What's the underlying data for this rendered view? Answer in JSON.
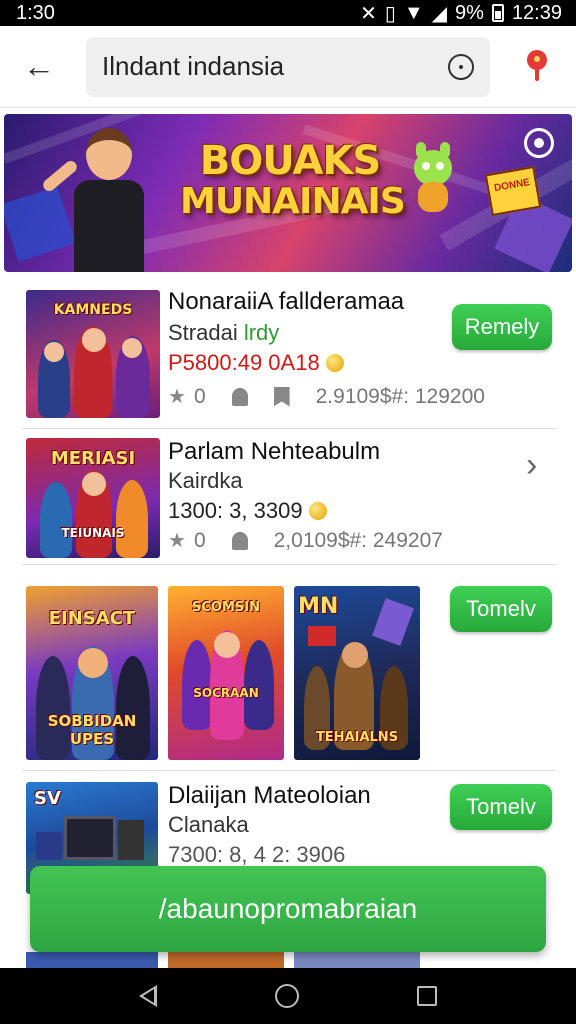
{
  "status_bar": {
    "time": "1:30",
    "battery": "9%",
    "clock": "12:39"
  },
  "search": {
    "value": "Ilndant indansia"
  },
  "banner": {
    "title_line1": "BOUAKS",
    "title_line2": "MUNAINAIS",
    "card_text": "DONNE"
  },
  "items": [
    {
      "thumb_label": "KAMNEDS",
      "title": "NonaraiiA fallderamaa",
      "subtitle": "Stradai",
      "subtitle_highlight": "lrdy",
      "price": "P5800:49 0A18",
      "stats": {
        "stars": "0",
        "meta": "2.9109$#: 129200"
      },
      "button": "Remely"
    },
    {
      "thumb_label": "MERIASI",
      "thumb_label2": "TEIUNAIS",
      "title": "Parlam Nehteabulm",
      "subtitle": "Kairdka",
      "price": "1300: 3, 3309",
      "stats": {
        "stars": "0",
        "meta": "2,0109$#: 249207"
      }
    }
  ],
  "gallery": [
    {
      "top": "EINSACT",
      "bottom": "SOBBIDAN UPES"
    },
    {
      "top": "SCOMSIN",
      "bottom": "SOCRAAN"
    },
    {
      "top": "MN",
      "bottom": "TEHAIALNS"
    }
  ],
  "gallery_button": "Tomelv",
  "item3": {
    "thumb_label": "SV",
    "title": "Dlaiijan Mateoloian",
    "subtitle": "Clanaka",
    "price": "7300: 8, 4 2: 3906",
    "button": "Tomelv"
  },
  "cta": {
    "label": "/abaunopromabraian"
  },
  "colors": {
    "accent_green": "#2ea742",
    "price_red": "#d01818"
  }
}
